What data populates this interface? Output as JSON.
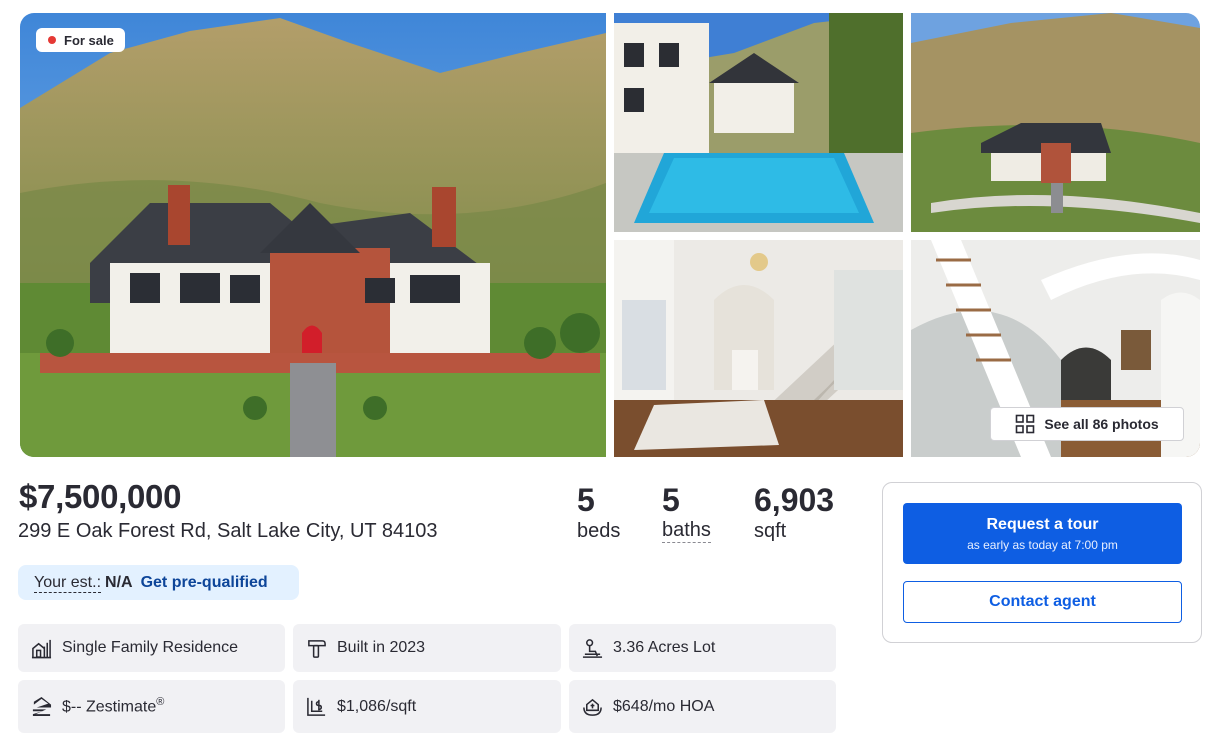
{
  "badge": {
    "label": "For sale"
  },
  "gallery": {
    "see_all_label": "See all 86 photos",
    "photos": [
      {
        "alt": "Tudor style home with mountains behind"
      },
      {
        "alt": "Backyard pool"
      },
      {
        "alt": "Aerial view of estate"
      },
      {
        "alt": "Foyer with curved staircase"
      },
      {
        "alt": "Staircase with mural wall"
      }
    ]
  },
  "listing": {
    "price": "$7,500,000",
    "address": "299 E Oak Forest Rd, Salt Lake City, UT 84103",
    "beds": {
      "value": "5",
      "label": "beds"
    },
    "baths": {
      "value": "5",
      "label": "baths"
    },
    "sqft": {
      "value": "6,903",
      "label": "sqft"
    }
  },
  "estimate": {
    "label": "Your est.:",
    "value": "N/A",
    "link": "Get pre-qualified"
  },
  "facts": {
    "type": "Single Family Residence",
    "built": "Built in 2023",
    "lot": "3.36 Acres Lot",
    "zestimate": "$-- Zestimate",
    "zestimate_mark": "®",
    "price_per_sqft": "$1,086/sqft",
    "hoa": "$648/mo HOA"
  },
  "contact": {
    "tour_label": "Request a tour",
    "tour_sub": "as early as today at 7:00 pm",
    "agent_label": "Contact agent"
  },
  "colors": {
    "primary": "#0e5ee3",
    "link": "#0d4599",
    "estimate_bg": "#e3f1ff",
    "fact_bg": "#f1f1f4",
    "for_sale_dot": "#e53935"
  }
}
